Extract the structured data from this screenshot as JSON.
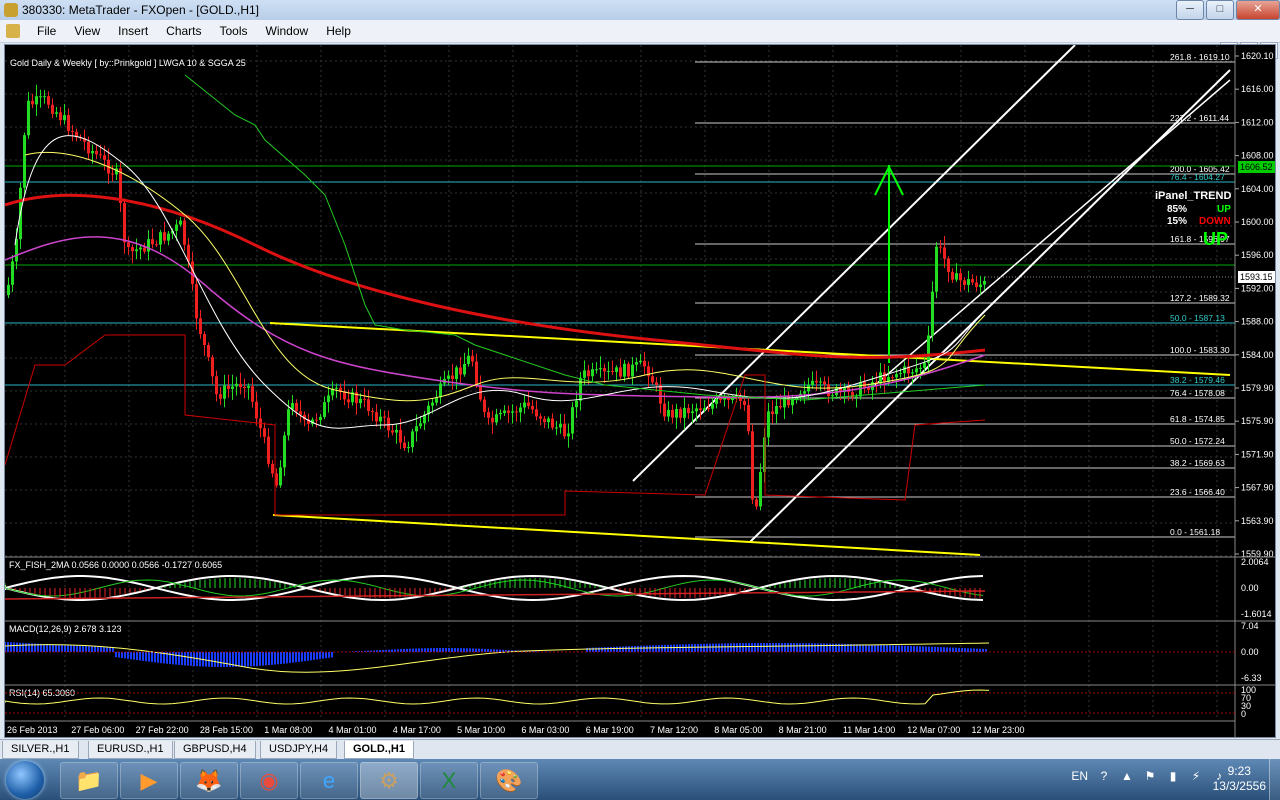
{
  "window": {
    "title": "380330: MetaTrader - FXOpen - [GOLD.,H1]"
  },
  "menu": {
    "items": [
      "File",
      "View",
      "Insert",
      "Charts",
      "Tools",
      "Window",
      "Help"
    ]
  },
  "mdi_buttons": [
    "_",
    "̅",
    "x"
  ],
  "chart": {
    "header": "Gold Daily & Weekly [ by::Prinkgold ]  LWGA 10  &  SGGA 25",
    "current_price": "1593.15",
    "price_axis": [
      "1620.10",
      "1616.00",
      "1612.00",
      "1608.00",
      "1604.00",
      "1600.00",
      "1596.00",
      "1592.00",
      "1588.00",
      "1584.00",
      "1579.90",
      "1575.90",
      "1571.90",
      "1567.90",
      "1563.90",
      "1559.90"
    ],
    "right_tag": "1606.52",
    "fib_levels": [
      {
        "label": "261.8 - 1619.10",
        "color": "#ffffff"
      },
      {
        "label": "227.2 - 1611.44",
        "color": "#ffffff"
      },
      {
        "label": "200.0 - 1605.42",
        "color": "#ffffff"
      },
      {
        "label": "76.4 - 1604.27",
        "color": "#33cccc"
      },
      {
        "label": "161.8 - 1596.97",
        "color": "#ffffff"
      },
      {
        "label": "127.2 - 1589.32",
        "color": "#ffffff"
      },
      {
        "label": "50.0 - 1587.13",
        "color": "#33cccc"
      },
      {
        "label": "100.0 - 1583.30",
        "color": "#ffffff"
      },
      {
        "label": "38.2 - 1579.46",
        "color": "#33cccc"
      },
      {
        "label": "76.4 - 1578.08",
        "color": "#ffffff"
      },
      {
        "label": "61.8 - 1574.85",
        "color": "#ffffff"
      },
      {
        "label": "50.0 - 1572.24",
        "color": "#ffffff"
      },
      {
        "label": "38.2 - 1569.63",
        "color": "#ffffff"
      },
      {
        "label": "23.6 - 1566.40",
        "color": "#ffffff"
      },
      {
        "label": "0.0 - 1561.18",
        "color": "#ffffff"
      }
    ],
    "ipanel": {
      "title": "iPanel_TREND",
      "up_pct": "85%",
      "up_label": "UP",
      "down_pct": "15%",
      "down_label": "DOWN",
      "big": "UP"
    },
    "time_axis": [
      "26 Feb 2013",
      "27 Feb 06:00",
      "27 Feb 22:00",
      "28 Feb 15:00",
      "1 Mar 08:00",
      "4 Mar 01:00",
      "4 Mar 17:00",
      "5 Mar 10:00",
      "6 Mar 03:00",
      "6 Mar 19:00",
      "7 Mar 12:00",
      "8 Mar 05:00",
      "8 Mar 21:00",
      "11 Mar 14:00",
      "12 Mar 07:00",
      "12 Mar 23:00"
    ],
    "indicators": [
      {
        "label": "FX_FISH_2MA 0.0566 0.0000 0.0566 -0.1727 0.6065",
        "axis": [
          "2.0064",
          "0.00",
          "-1.6014"
        ]
      },
      {
        "label": "MACD(12,26,9) 2.678 3.123",
        "axis": [
          "7.04",
          "0.00",
          "-6.33"
        ]
      },
      {
        "label": "RSI(14) 65.3060",
        "axis": [
          "100",
          "70",
          "30",
          "0"
        ]
      }
    ]
  },
  "tabs": [
    "SILVER.,H1",
    "EURUSD.,H1",
    "GBPUSD,H4",
    "USDJPY,H4",
    "GOLD.,H1"
  ],
  "active_tab": "GOLD.,H1",
  "taskbar": {
    "apps": [
      {
        "name": "explorer-icon",
        "glyph": "📁"
      },
      {
        "name": "media-player-icon",
        "glyph": "▶"
      },
      {
        "name": "firefox-icon",
        "glyph": "🦊"
      },
      {
        "name": "chrome-icon",
        "glyph": "◉"
      },
      {
        "name": "ie-icon",
        "glyph": "e"
      },
      {
        "name": "metatrader-icon",
        "glyph": "⚙"
      },
      {
        "name": "excel-icon",
        "glyph": "X"
      },
      {
        "name": "paint-icon",
        "glyph": "🎨"
      }
    ],
    "lang": "EN",
    "time": "9:23",
    "date": "13/3/2556"
  }
}
